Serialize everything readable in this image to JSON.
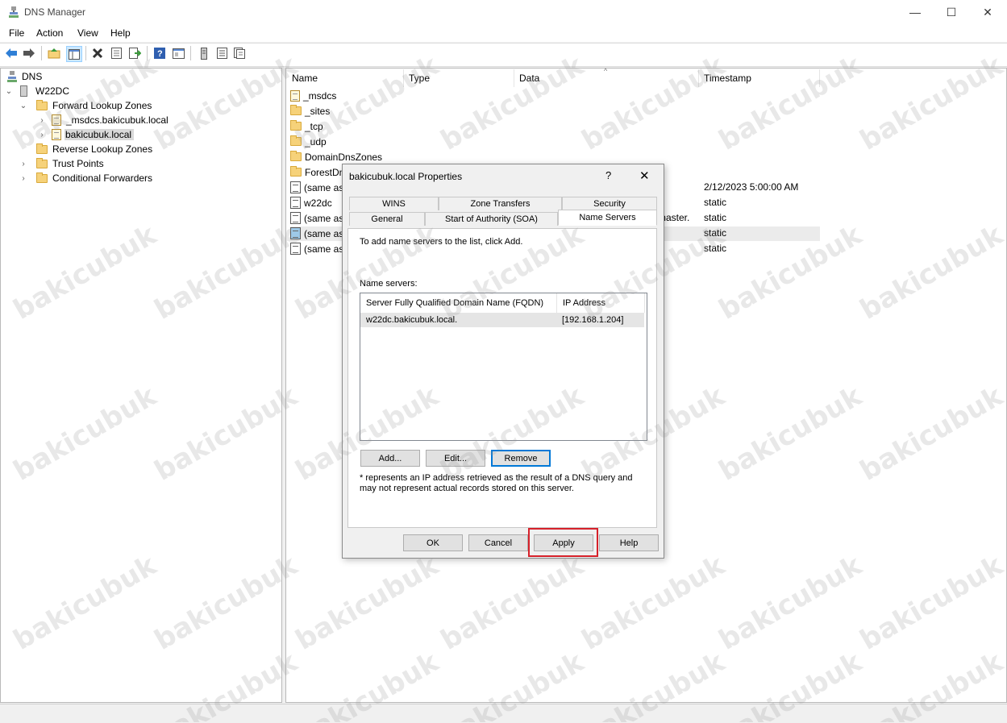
{
  "window": {
    "title": "DNS Manager",
    "minimize": "—",
    "maximize": "☐",
    "close": "✕"
  },
  "menu": [
    "File",
    "Action",
    "View",
    "Help"
  ],
  "toolbar": {
    "icons": [
      "back-icon",
      "forward-icon",
      "up-folder-icon",
      "show-hide-tree-icon",
      "delete-icon",
      "properties-icon",
      "export-icon",
      "help-icon",
      "console-icon",
      "server-icon",
      "list-icon",
      "zone-icon"
    ]
  },
  "tree": {
    "root": "DNS",
    "server": "W22DC",
    "forward_zones": "Forward Lookup Zones",
    "msdcs": "_msdcs.bakicubuk.local",
    "selected_zone": "bakicubuk.local",
    "reverse_zones": "Reverse Lookup Zones",
    "trust_points": "Trust Points",
    "conditional_forwarders": "Conditional Forwarders"
  },
  "list": {
    "columns": [
      "Name",
      "Type",
      "Data",
      "Timestamp"
    ],
    "rows": [
      {
        "name": "_msdcs",
        "icon": "zone",
        "data": "",
        "timestamp": ""
      },
      {
        "name": "_sites",
        "icon": "folder",
        "data": "",
        "timestamp": ""
      },
      {
        "name": "_tcp",
        "icon": "folder",
        "data": "",
        "timestamp": ""
      },
      {
        "name": "_udp",
        "icon": "folder",
        "data": "",
        "timestamp": ""
      },
      {
        "name": "DomainDnsZones",
        "icon": "folder",
        "data": "",
        "timestamp": ""
      },
      {
        "name": "ForestDn",
        "icon": "folder",
        "data": "",
        "timestamp": ""
      },
      {
        "name": "(same as",
        "icon": "record",
        "data": "",
        "timestamp": "2/12/2023 5:00:00 AM"
      },
      {
        "name": "w22dc",
        "icon": "record",
        "data": "",
        "timestamp": "static"
      },
      {
        "name": "(same as",
        "icon": "record",
        "data": "master.",
        "timestamp": "static"
      },
      {
        "name": "(same as",
        "icon": "record-selected",
        "data": "",
        "timestamp": "static"
      },
      {
        "name": "(same as",
        "icon": "record",
        "data": "",
        "timestamp": "static"
      }
    ]
  },
  "dialog": {
    "title": "bakicubuk.local Properties",
    "help": "?",
    "close": "✕",
    "tabs_row1": [
      "WINS",
      "Zone Transfers",
      "Security"
    ],
    "tabs_row2": [
      "General",
      "Start of Authority (SOA)",
      "Name Servers"
    ],
    "instruction": "To add name servers to the list, click Add.",
    "name_servers_label": "Name servers:",
    "columns": [
      "Server Fully Qualified Domain Name (FQDN)",
      "IP Address"
    ],
    "servers": [
      {
        "fqdn": "w22dc.bakicubuk.local.",
        "ip": "[192.168.1.204]"
      }
    ],
    "buttons": {
      "add": "Add...",
      "edit": "Edit...",
      "remove": "Remove"
    },
    "note": "* represents an IP address retrieved as the result of a DNS query and may not represent actual records stored on this server.",
    "footer": {
      "ok": "OK",
      "cancel": "Cancel",
      "apply": "Apply",
      "help": "Help"
    }
  },
  "watermark": "bakicubuk",
  "colors": {
    "highlight": "#d6212a",
    "focus": "#0078d7",
    "selection": "#cce8ff"
  }
}
